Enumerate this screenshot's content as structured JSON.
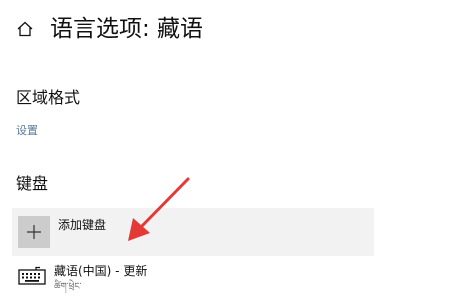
{
  "header": {
    "home_icon": "home-icon",
    "title": "语言选项: 藏语"
  },
  "region": {
    "heading": "区域格式",
    "settings_link": "设置"
  },
  "keyboard": {
    "heading": "键盘",
    "add_label": "添加键盘",
    "add_icon": "plus-icon",
    "entries": [
      {
        "icon": "keyboard-icon",
        "name": "藏语(中国) - 更新",
        "subtitle": "ཚིག་ཕྲེང་"
      }
    ]
  },
  "annotation": {
    "arrow_color": "#e53935"
  }
}
